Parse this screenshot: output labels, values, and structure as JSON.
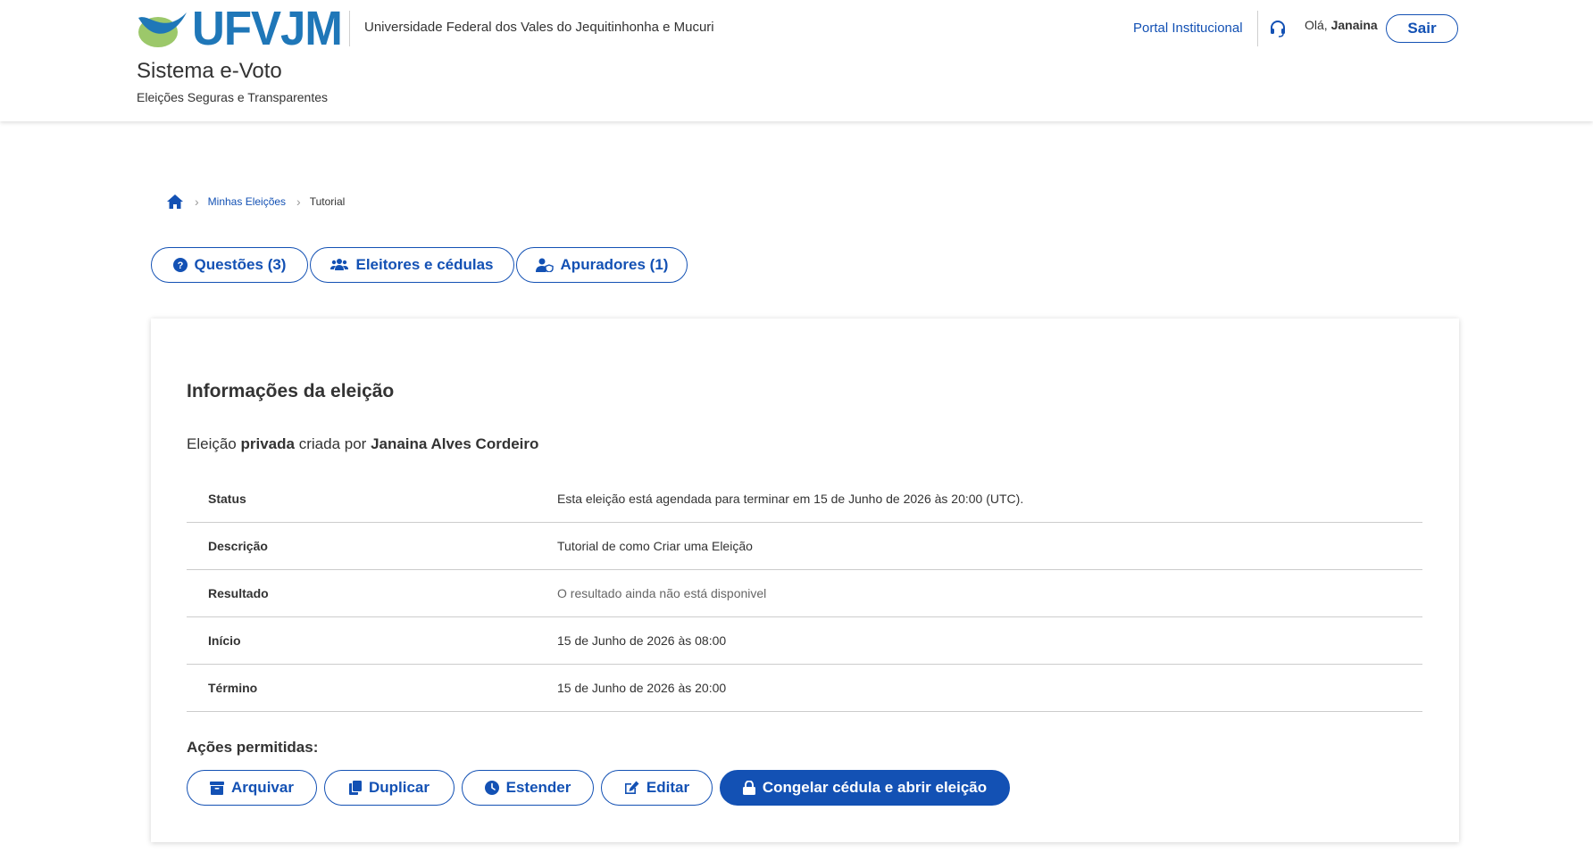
{
  "header": {
    "logo_text": "UFVJM",
    "university_name": "Universidade Federal dos Vales do Jequitinhonha e Mucuri",
    "system_title": "Sistema e-Voto",
    "system_subtitle": "Eleições Seguras e Transparentes",
    "portal_link": "Portal Institucional",
    "greeting_prefix": "Olá,",
    "user_name": "Janaina",
    "logout_label": "Sair"
  },
  "breadcrumb": {
    "home_icon": "home-icon",
    "items": [
      {
        "label": "Minhas Eleições"
      },
      {
        "label": "Tutorial"
      }
    ]
  },
  "tabs": [
    {
      "label": "Questões (3)",
      "icon": "question-circle-icon"
    },
    {
      "label": "Eleitores e cédulas",
      "icon": "users-icon"
    },
    {
      "label": "Apuradores (1)",
      "icon": "user-shield-icon"
    }
  ],
  "card": {
    "title": "Informações da eleição",
    "meta": {
      "prefix": "Eleição",
      "visibility": "privada",
      "middle": "criada por",
      "creator": "Janaina Alves Cordeiro"
    },
    "rows": [
      {
        "label": "Status",
        "value": "Esta eleição está agendada para terminar em 15 de Junho de 2026 às 20:00 (UTC)."
      },
      {
        "label": "Descrição",
        "value": "Tutorial de como Criar uma Eleição"
      },
      {
        "label": "Resultado",
        "value": "O resultado ainda não está disponivel"
      },
      {
        "label": "Início",
        "value": "15 de Junho de 2026 às 08:00"
      },
      {
        "label": "Término",
        "value": "15 de Junho de 2026 às 20:00"
      }
    ],
    "actions_label": "Ações permitidas:",
    "actions": [
      {
        "label": "Arquivar",
        "icon": "archive-icon"
      },
      {
        "label": "Duplicar",
        "icon": "copy-icon"
      },
      {
        "label": "Estender",
        "icon": "clock-icon"
      },
      {
        "label": "Editar",
        "icon": "edit-icon"
      },
      {
        "label": "Congelar cédula e abrir eleição",
        "icon": "lock-icon"
      }
    ]
  },
  "colors": {
    "primary": "#1351b4",
    "logo_blue": "#1f77b8",
    "logo_green": "#9cc86a",
    "text": "#333333"
  }
}
